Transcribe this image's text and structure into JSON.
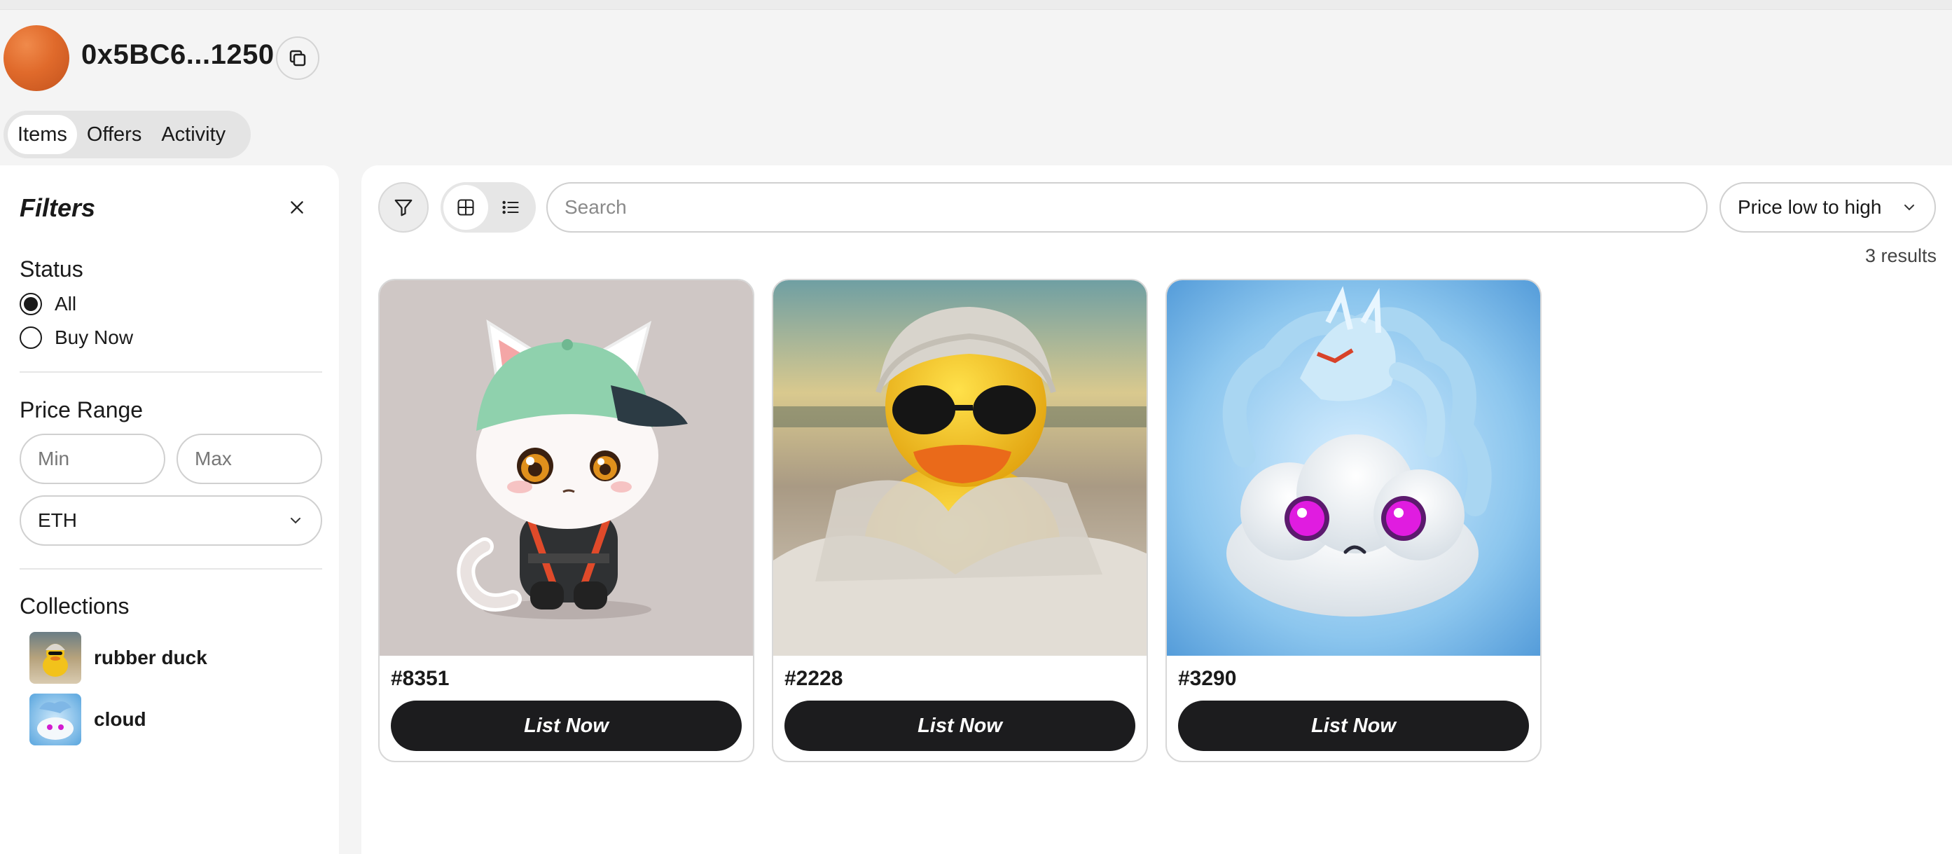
{
  "header": {
    "address": "0x5BC6...1250",
    "copy_icon": "copy-icon"
  },
  "tabs": [
    {
      "label": "Items",
      "active": true
    },
    {
      "label": "Offers",
      "active": false
    },
    {
      "label": "Activity",
      "active": false
    }
  ],
  "filters": {
    "title": "Filters",
    "close_icon": "close-icon",
    "status": {
      "heading": "Status",
      "options": [
        {
          "label": "All",
          "selected": true
        },
        {
          "label": "Buy Now",
          "selected": false
        }
      ]
    },
    "price_range": {
      "heading": "Price Range",
      "min_placeholder": "Min",
      "max_placeholder": "Max",
      "currency": "ETH"
    },
    "collections": {
      "heading": "Collections",
      "items": [
        {
          "name": "rubber duck"
        },
        {
          "name": "cloud"
        }
      ]
    }
  },
  "toolbar": {
    "search_placeholder": "Search",
    "sort_label": "Price low to high",
    "results_text": "3 results"
  },
  "items": [
    {
      "id": "#8351",
      "button": "List Now",
      "image": "cat-in-cap"
    },
    {
      "id": "#2228",
      "button": "List Now",
      "image": "duck-with-sunglasses"
    },
    {
      "id": "#3290",
      "button": "List Now",
      "image": "cloud-with-dragon"
    }
  ],
  "colors": {
    "accent_dark": "#1c1c1e",
    "avatar_orange": "#e06a2b",
    "background": "#f4f4f4"
  }
}
